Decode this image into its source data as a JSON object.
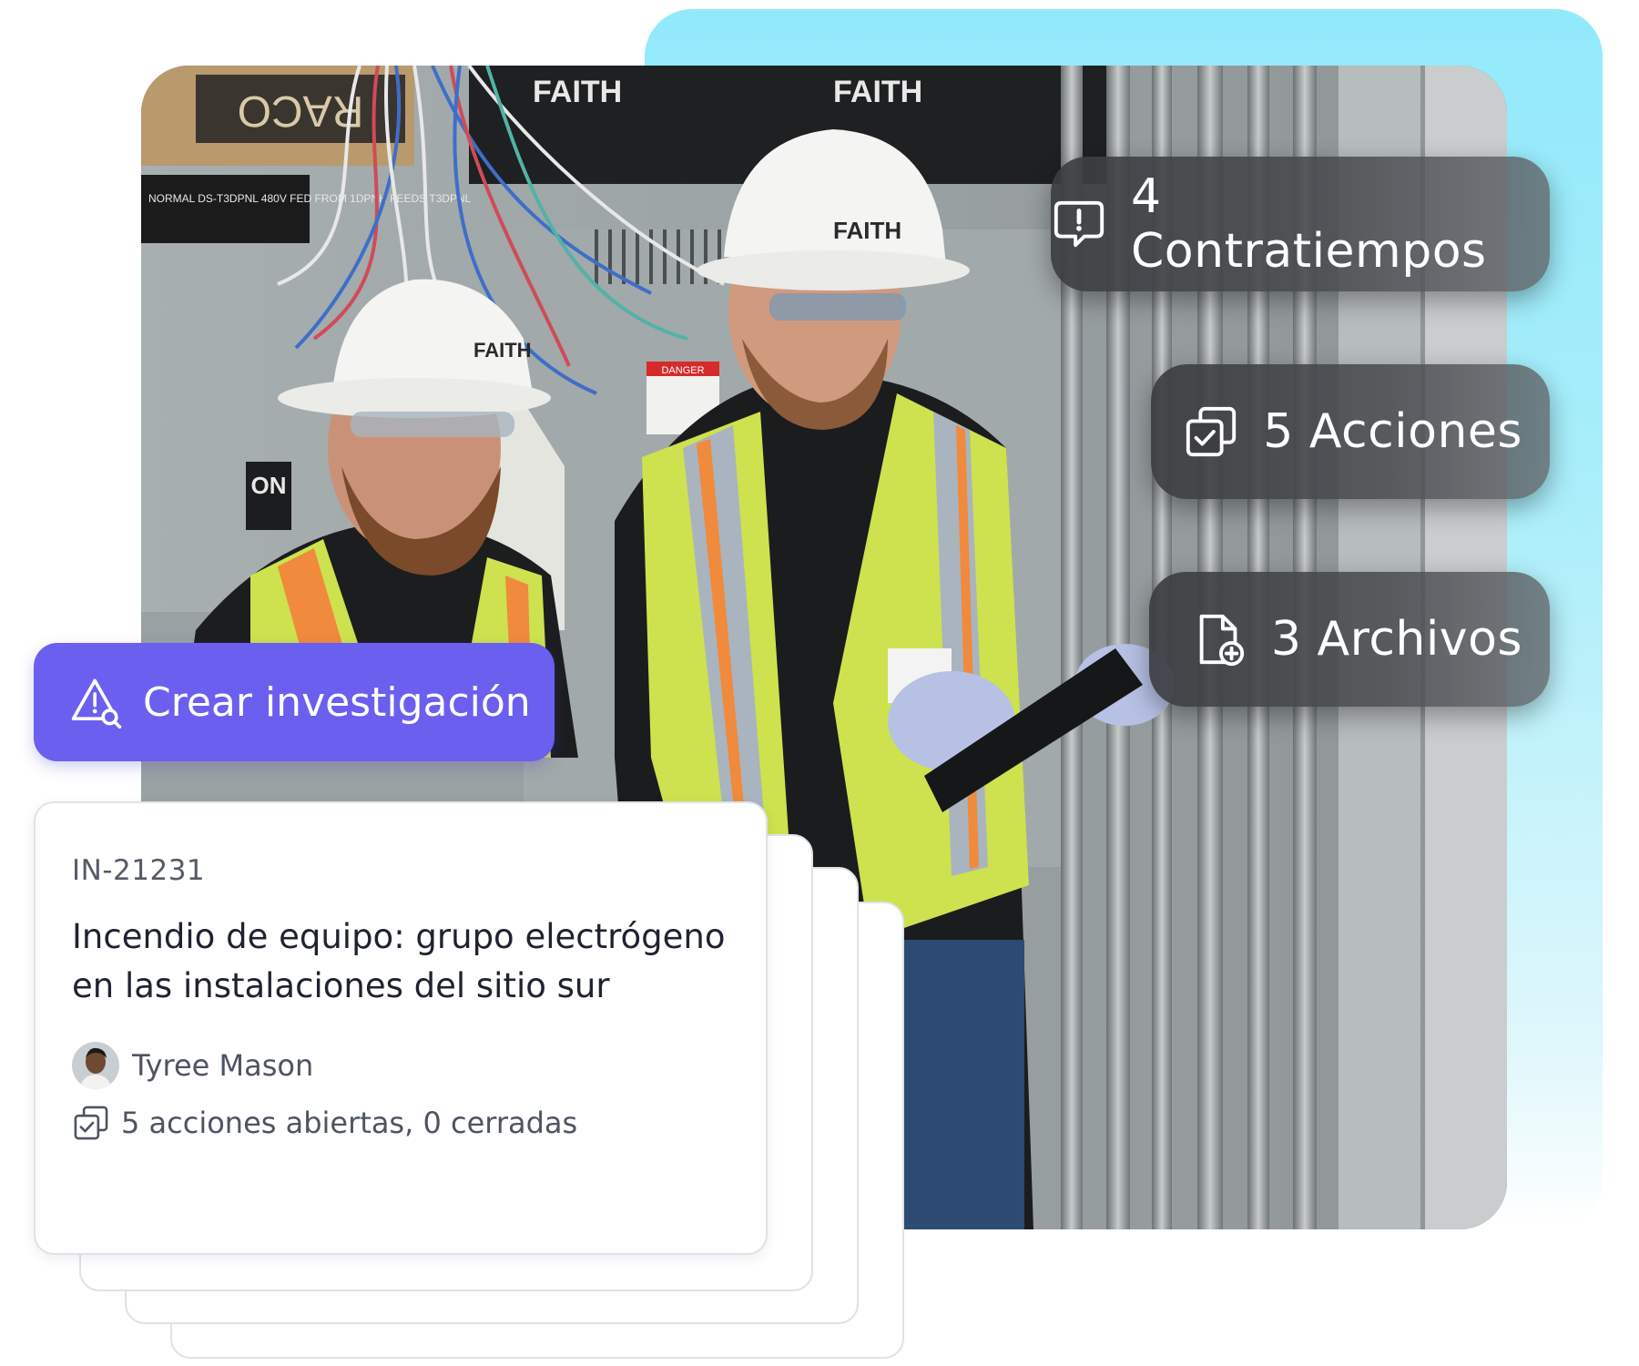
{
  "photo": {
    "signs": {
      "brand_top_left": "RACO",
      "panel_label": "NORMAL DS-T3DPNL 480V FED FROM 1DPNH FEEDS T3DPNL",
      "danger": "DANGER",
      "switch": "ON"
    },
    "brand_marks": [
      "FAITH",
      "FAITH",
      "FAITH",
      "FAITH"
    ]
  },
  "stats": {
    "setbacks": {
      "label": "4 Contratiempos",
      "icon": "message-alert-icon"
    },
    "actions": {
      "label": "5 Acciones",
      "icon": "copy-check-icon"
    },
    "files": {
      "label": "3 Archivos",
      "icon": "file-plus-icon"
    }
  },
  "create_button": {
    "label": "Crear investigación",
    "icon": "warning-search-icon"
  },
  "incident_card": {
    "id": "IN-21231",
    "title": "Incendio de equipo: grupo electrógeno en las instalaciones del sitio sur",
    "author": "Tyree Mason",
    "actions_summary": "5 acciones abiertas, 0 cerradas"
  },
  "colors": {
    "accent": "#6a5fef",
    "cyan_panel": "#92e9fb",
    "pill_bg": "#3c3e42",
    "vest": "#cfe64a"
  }
}
